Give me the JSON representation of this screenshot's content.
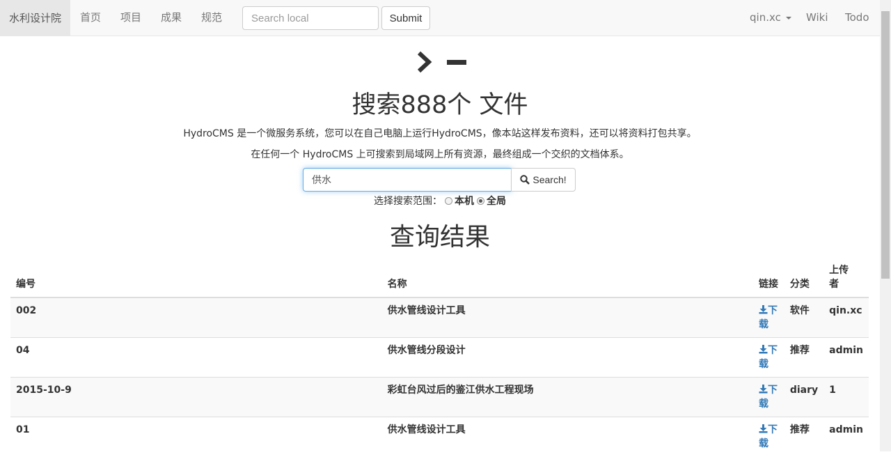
{
  "navbar": {
    "brand": "水利设计院",
    "links": [
      "首页",
      "项目",
      "成果",
      "规范"
    ],
    "search_placeholder": "Search local",
    "submit_label": "Submit",
    "user": "qin.xc",
    "wiki": "Wiki",
    "todo": "Todo"
  },
  "hero": {
    "title": "搜索888个 文件",
    "line1": "HydroCMS 是一个微服务系统，您可以在自己电脑上运行HydroCMS，像本站这样发布资料，还可以将资料打包共享。",
    "line2": "在任何一个 HydroCMS 上可搜索到局域网上所有资源，最终组成一个交织的文档体系。",
    "search_value": "供水",
    "search_button": "Search!",
    "scope_label": "选择搜索范围：",
    "scope_local": "本机",
    "scope_global": "全局"
  },
  "results": {
    "title": "查询结果",
    "headers": {
      "id": "编号",
      "name": "名称",
      "link": "链接",
      "category": "分类",
      "uploader_1": "上传",
      "uploader_2": "者"
    },
    "download_1": "下",
    "download_2": "载",
    "rows": [
      {
        "id": "002",
        "name": "供水管线设计工具",
        "category": "软件",
        "uploader": "qin.xc"
      },
      {
        "id": "04",
        "name": "供水管线分段设计",
        "category": "推荐",
        "uploader": "admin"
      },
      {
        "id": "2015-10-9",
        "name": "彩虹台风过后的鉴江供水工程现场",
        "category": "diary",
        "uploader": "1"
      },
      {
        "id": "01",
        "name": "供水管线设计工具",
        "category": "推荐",
        "uploader": "admin"
      }
    ]
  },
  "colors": {
    "link": "#337ab7",
    "navbar_bg": "#f8f8f8",
    "focus": "#66afe9"
  },
  "icons": [
    "terminal-icon",
    "search-icon",
    "download-icon",
    "caret-down-icon"
  ]
}
